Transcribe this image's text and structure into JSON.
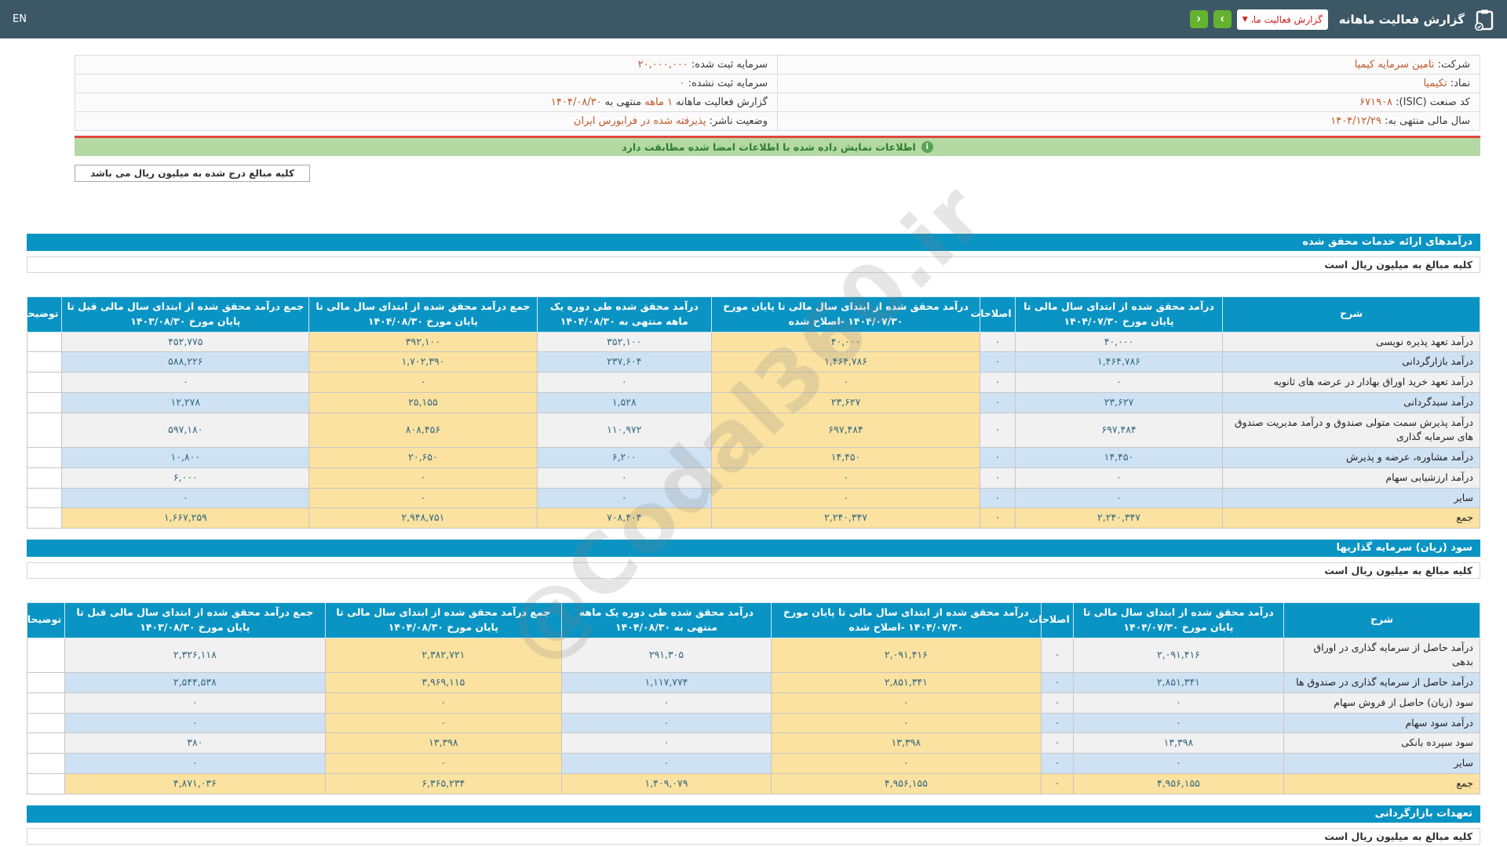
{
  "colors": {
    "topbar": "#3c5766",
    "header_blue": "#0a94c4",
    "row_light": "#f1f1f1",
    "row_blue": "#cfe2f4",
    "highlight_yellow": "#fbe2a0",
    "green_button": "#63b32e",
    "success_bg": "#b4d9a3",
    "accent_orange": "#c0582a",
    "alert_red_line": "#e2473c",
    "dropdown_red_text": "#cf2020",
    "number_teal": "#33677f"
  },
  "topbar": {
    "lang": "EN",
    "title": "گزارش فعالیت ماهانه",
    "report_select_value": "گزارش فعالیت ماهانه",
    "icons": {
      "clipboard": "clipboard-report-icon",
      "forward": "chevron-right-icon",
      "back": "chevron-left-icon",
      "caret": "chevron-down-icon",
      "info": "info-circle-icon"
    }
  },
  "company_info": {
    "rows": [
      {
        "right": [
          {
            "text": "شرکت:  "
          },
          {
            "text": "تامین سرمایه کیمیا",
            "accent": true
          }
        ],
        "left": [
          {
            "text": "سرمایه ثبت شده:  "
          },
          {
            "text": "۲۰,۰۰۰,۰۰۰",
            "accent": true
          }
        ]
      },
      {
        "right": [
          {
            "text": "نماد:  "
          },
          {
            "text": "تکیمیا",
            "accent": true
          }
        ],
        "left": [
          {
            "text": "سرمایه ثبت نشده:  "
          },
          {
            "text": "۰",
            "accent": true
          }
        ]
      },
      {
        "right": [
          {
            "text": "کد صنعت (ISIC):  "
          },
          {
            "text": "۶۷۱۹۰۸",
            "accent": true
          }
        ],
        "left": [
          {
            "text": "گزارش فعالیت ماهانه "
          },
          {
            "text": "۱ ماهه",
            "accent": true
          },
          {
            "text": " منتهی به "
          },
          {
            "text": "۱۴۰۴/۰۸/۳۰",
            "accent": true
          }
        ]
      },
      {
        "right": [
          {
            "text": "سال مالی منتهی به:  "
          },
          {
            "text": "۱۴۰۴/۱۲/۲۹",
            "accent": true
          }
        ],
        "left": [
          {
            "text": "وضعیت ناشر:  "
          },
          {
            "text": "پذیرفته شده در فرابورس ایران",
            "accent": true
          }
        ]
      }
    ]
  },
  "notice": "اطلاعات نمایش داده شده با اطلاعات امضا شده مطابقت دارد",
  "unit_note_box": "کلیه مبالغ درج شده به میلیون ریال می باشد",
  "watermark": "@Codal360.ir",
  "sections": [
    {
      "title": "درآمدهای ارائه خدمات محقق شده",
      "unit_note": "کلیه مبالغ به میلیون ریال است",
      "table": {
        "headers": [
          "شرح",
          "درآمد محقق شده از ابتدای سال مالی تا پایان مورخ ۱۴۰۴/۰۷/۳۰",
          "اصلاحات",
          "درآمد محقق شده از ابتدای سال مالی تا پایان مورخ ۱۴۰۴/۰۷/۳۰ -اصلاح شده",
          "درآمد محقق شده طی دوره یک ماهه منتهی به ۱۴۰۴/۰۸/۳۰",
          "جمع درآمد محقق شده از ابتدای سال مالی تا پایان مورخ ۱۴۰۴/۰۸/۳۰",
          "جمع درآمد محقق شده از ابتدای سال مالی قبل تا پایان مورخ ۱۴۰۳/۰۸/۳۰",
          "توضیحات"
        ],
        "rows": [
          {
            "label": "درآمد تعهد پذیره نویسی",
            "values": [
              "۴۰,۰۰۰",
              "۰",
              "۴۰,۰۰۰",
              "۳۵۲,۱۰۰",
              "۳۹۲,۱۰۰",
              "۴۵۲,۷۷۵"
            ],
            "notes": ""
          },
          {
            "label": "درآمد بازارگردانی",
            "values": [
              "۱,۴۶۴,۷۸۶",
              "۰",
              "۱,۴۶۴,۷۸۶",
              "۲۳۷,۶۰۴",
              "۱,۷۰۲,۳۹۰",
              "۵۸۸,۲۲۶"
            ],
            "notes": ""
          },
          {
            "label": "درآمد تعهد خرید اوراق بهادار در عرضه های ثانویه",
            "values": [
              "۰",
              "۰",
              "۰",
              "۰",
              "۰",
              "۰"
            ],
            "notes": ""
          },
          {
            "label": "درآمد سبدگردانی",
            "values": [
              "۲۳,۶۲۷",
              "۰",
              "۲۳,۶۲۷",
              "۱,۵۲۸",
              "۲۵,۱۵۵",
              "۱۲,۲۷۸"
            ],
            "notes": ""
          },
          {
            "label": "درآمد پذیرش سمت متولی صندوق و درآمد مدیریت صندوق های سرمایه گذاری",
            "values": [
              "۶۹۷,۴۸۴",
              "۰",
              "۶۹۷,۴۸۴",
              "۱۱۰,۹۷۲",
              "۸۰۸,۴۵۶",
              "۵۹۷,۱۸۰"
            ],
            "notes": ""
          },
          {
            "label": "درآمد مشاوره، عرضه و پذیرش",
            "values": [
              "۱۴,۴۵۰",
              "۰",
              "۱۴,۴۵۰",
              "۶,۲۰۰",
              "۲۰,۶۵۰",
              "۱۰,۸۰۰"
            ],
            "notes": ""
          },
          {
            "label": "درآمد ارزشیابی سهام",
            "values": [
              "۰",
              "۰",
              "۰",
              "۰",
              "۰",
              "۶,۰۰۰"
            ],
            "notes": ""
          },
          {
            "label": "سایر",
            "values": [
              "۰",
              "۰",
              "۰",
              "۰",
              "۰",
              "۰"
            ],
            "notes": ""
          },
          {
            "label": "جمع",
            "values": [
              "۲,۲۴۰,۳۴۷",
              "۰",
              "۲,۲۴۰,۳۴۷",
              "۷۰۸,۴۰۴",
              "۲,۹۴۸,۷۵۱",
              "۱,۶۶۷,۲۵۹"
            ],
            "notes": "",
            "is_total": true
          }
        ]
      }
    },
    {
      "title": "سود (زیان) سرمایه گذاریها",
      "unit_note": "کلیه مبالغ به میلیون ریال است",
      "table": {
        "headers": [
          "شرح",
          "درآمد محقق شده از ابتدای سال مالی تا پایان مورخ ۱۴۰۴/۰۷/۳۰",
          "اصلاحات",
          "درآمد محقق شده از ابتدای سال مالی تا پایان مورخ ۱۴۰۴/۰۷/۳۰ -اصلاح شده",
          "درآمد محقق شده طی دوره یک ماهه منتهی به ۱۴۰۴/۰۸/۳۰",
          "جمع درآمد محقق شده از ابتدای سال مالی تا پایان مورخ ۱۴۰۴/۰۸/۳۰",
          "جمع درآمد محقق شده از ابتدای سال مالی قبل تا پایان مورخ ۱۴۰۳/۰۸/۳۰",
          "توضیحات"
        ],
        "rows": [
          {
            "label": "درآمد حاصل از سرمایه گذاری در اوراق بدهی",
            "values": [
              "۲,۰۹۱,۴۱۶",
              "۰",
              "۲,۰۹۱,۴۱۶",
              "۲۹۱,۳۰۵",
              "۲,۳۸۲,۷۲۱",
              "۲,۳۲۶,۱۱۸"
            ],
            "notes": ""
          },
          {
            "label": "درآمد حاصل از سرمایه گذاری در صندوق ها",
            "values": [
              "۲,۸۵۱,۳۴۱",
              "۰",
              "۲,۸۵۱,۳۴۱",
              "۱,۱۱۷,۷۷۴",
              "۳,۹۶۹,۱۱۵",
              "۲,۵۴۴,۵۳۸"
            ],
            "notes": ""
          },
          {
            "label": "سود (زیان) حاصل از فروش سهام",
            "values": [
              "۰",
              "۰",
              "۰",
              "۰",
              "۰",
              "۰"
            ],
            "notes": ""
          },
          {
            "label": "درآمد سود سهام",
            "values": [
              "۰",
              "۰",
              "۰",
              "۰",
              "۰",
              "۰"
            ],
            "notes": ""
          },
          {
            "label": "سود سپرده بانکی",
            "values": [
              "۱۳,۳۹۸",
              "۰",
              "۱۳,۳۹۸",
              "۰",
              "۱۳,۳۹۸",
              "۳۸۰"
            ],
            "notes": ""
          },
          {
            "label": "سایر",
            "values": [
              "۰",
              "۰",
              "۰",
              "۰",
              "۰",
              "۰"
            ],
            "notes": ""
          },
          {
            "label": "جمع",
            "values": [
              "۴,۹۵۶,۱۵۵",
              "۰",
              "۴,۹۵۶,۱۵۵",
              "۱,۴۰۹,۰۷۹",
              "۶,۳۶۵,۲۳۴",
              "۴,۸۷۱,۰۳۶"
            ],
            "notes": "",
            "is_total": true
          }
        ]
      }
    },
    {
      "title": "تعهدات بازارگردانی",
      "unit_note": "کلیه مبالغ به میلیون ریال است",
      "table": null
    }
  ]
}
